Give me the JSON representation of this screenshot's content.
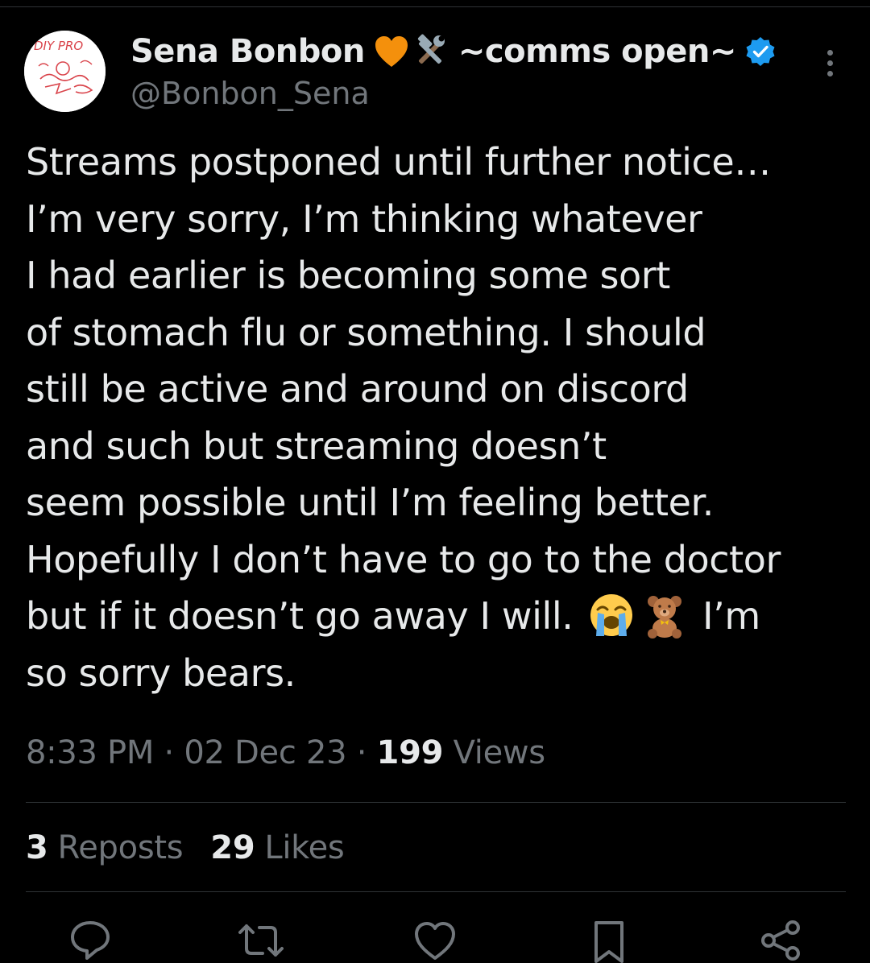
{
  "tweet": {
    "author": {
      "display_name": "Sena Bonbon",
      "name_suffix": "~comms open~",
      "handle": "@Bonbon_Sena",
      "avatar_text": "DIY PRO"
    },
    "text_lines": [
      "Streams postponed until further notice…",
      "I’m very sorry, I’m thinking whatever",
      "I had earlier is becoming some sort",
      "of stomach flu or something. I should",
      "still be active and around on discord",
      "and such but streaming doesn’t",
      "seem possible until I’m feeling better.",
      "Hopefully I don’t have to go to the doctor",
      "but if it doesn’t go away I will.",
      "I’m",
      "so sorry bears."
    ],
    "emoji": {
      "name": [
        "orange-heart-icon",
        "hammer-and-wrench-icon"
      ],
      "inline": [
        "loudly-crying-face-icon",
        "teddy-bear-icon"
      ]
    },
    "meta": {
      "time": "8:33 PM",
      "separator": "·",
      "date": "02 Dec 23",
      "views_count": "199",
      "views_label": "Views"
    },
    "stats": {
      "reposts_count": "3",
      "reposts_label": "Reposts",
      "likes_count": "29",
      "likes_label": "Likes"
    },
    "actions": [
      "reply-icon",
      "repost-icon",
      "like-icon",
      "bookmark-icon",
      "share-icon"
    ]
  },
  "colors": {
    "background": "#000000",
    "text_primary": "#e7e9ea",
    "text_secondary": "#71767b",
    "divider": "#2f3336",
    "verified_blue": "#1d9bf0"
  }
}
